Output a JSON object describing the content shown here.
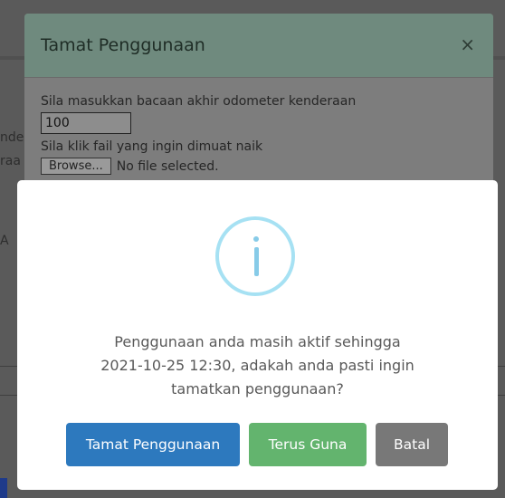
{
  "modal": {
    "title": "Tamat Penggunaan",
    "close_symbol": "×",
    "odometer_label": "Sila masukkan bacaan akhir odometer kenderaan",
    "odometer_value": "100",
    "file_label": "Sila klik fail yang ingin dimuat naik",
    "browse_label": "Browse...",
    "file_status": "No file selected."
  },
  "background": {
    "fragment_1": "nde",
    "fragment_2": "raa",
    "fragment_3": "A"
  },
  "alert": {
    "icon": "info-icon",
    "icon_color": "#a6e1f3",
    "message": "Penggunaan anda masih aktif sehingga\n2021-10-25 12:30, adakah anda pasti ingin\ntamatkan penggunaan?",
    "buttons": {
      "end_label": "Tamat Penggunaan",
      "end_color": "#2d79be",
      "continue_label": "Terus Guna",
      "continue_color": "#63b46e",
      "cancel_label": "Batal",
      "cancel_color": "#787878"
    }
  }
}
